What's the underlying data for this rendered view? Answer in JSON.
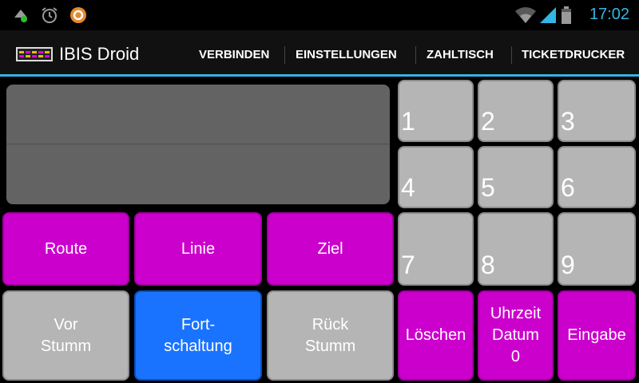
{
  "status_bar": {
    "time": "17:02",
    "icons": [
      "usb-debug-icon",
      "alarm-icon",
      "app-notification-icon",
      "wifi-icon",
      "signal-icon",
      "battery-icon"
    ],
    "accent_color": "#33b5e5"
  },
  "action_bar": {
    "title": "IBIS Droid",
    "menu": [
      "VERBINDEN",
      "EINSTELLUNGEN",
      "ZAHLTISCH",
      "TICKETDRUCKER"
    ]
  },
  "display": {
    "text": ""
  },
  "function_buttons": {
    "route": "Route",
    "linie": "Linie",
    "ziel": "Ziel",
    "vor_stumm": "Vor\nStumm",
    "fortschaltung": "Fort-\nschaltung",
    "rueck_stumm": "Rück\nStumm"
  },
  "keypad": {
    "keys": [
      "1",
      "2",
      "3",
      "4",
      "5",
      "6",
      "7",
      "8",
      "9"
    ],
    "loeschen": "Löschen",
    "uhrzeit_datum": "Uhrzeit\nDatum\n0",
    "eingabe": "Eingabe"
  },
  "colors": {
    "magenta": "#cc00cc",
    "grey": "#b5b5b5",
    "blue": "#1a73ff",
    "display": "#636363"
  }
}
